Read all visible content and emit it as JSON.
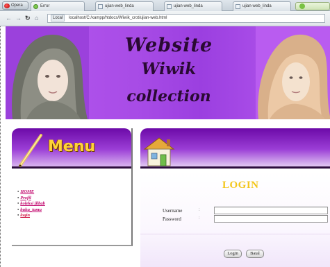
{
  "browser": {
    "menu_button": "Opera",
    "tabs": [
      {
        "label": "Error",
        "active": true
      },
      {
        "label": "ujian-web_linda",
        "active": false
      },
      {
        "label": "ujian-web_linda",
        "active": false
      },
      {
        "label": "ujian-web_linda",
        "active": false
      }
    ],
    "address": {
      "badge": "Local",
      "url": "localhost/C:/xampp/htdocs/Wiwik_crot/ujian-web.html"
    }
  },
  "banner": {
    "line1": "Website",
    "line2": "Wiwik",
    "line3": "collection"
  },
  "menu": {
    "title": "Menu",
    "items": [
      "HOME",
      "Profil",
      "koleksi jilbab",
      "buku_tamu",
      "login"
    ]
  },
  "login": {
    "title": "LOGIN",
    "username_label": "Username",
    "password_label": "Password",
    "colon": ":",
    "login_button": "Login",
    "cancel_button": "Batal"
  },
  "colors": {
    "banner_purple": "#a84ce6",
    "header_purple": "#6c0aa8",
    "title_gold": "#f3c61b",
    "menu_link": "#c0006a"
  }
}
